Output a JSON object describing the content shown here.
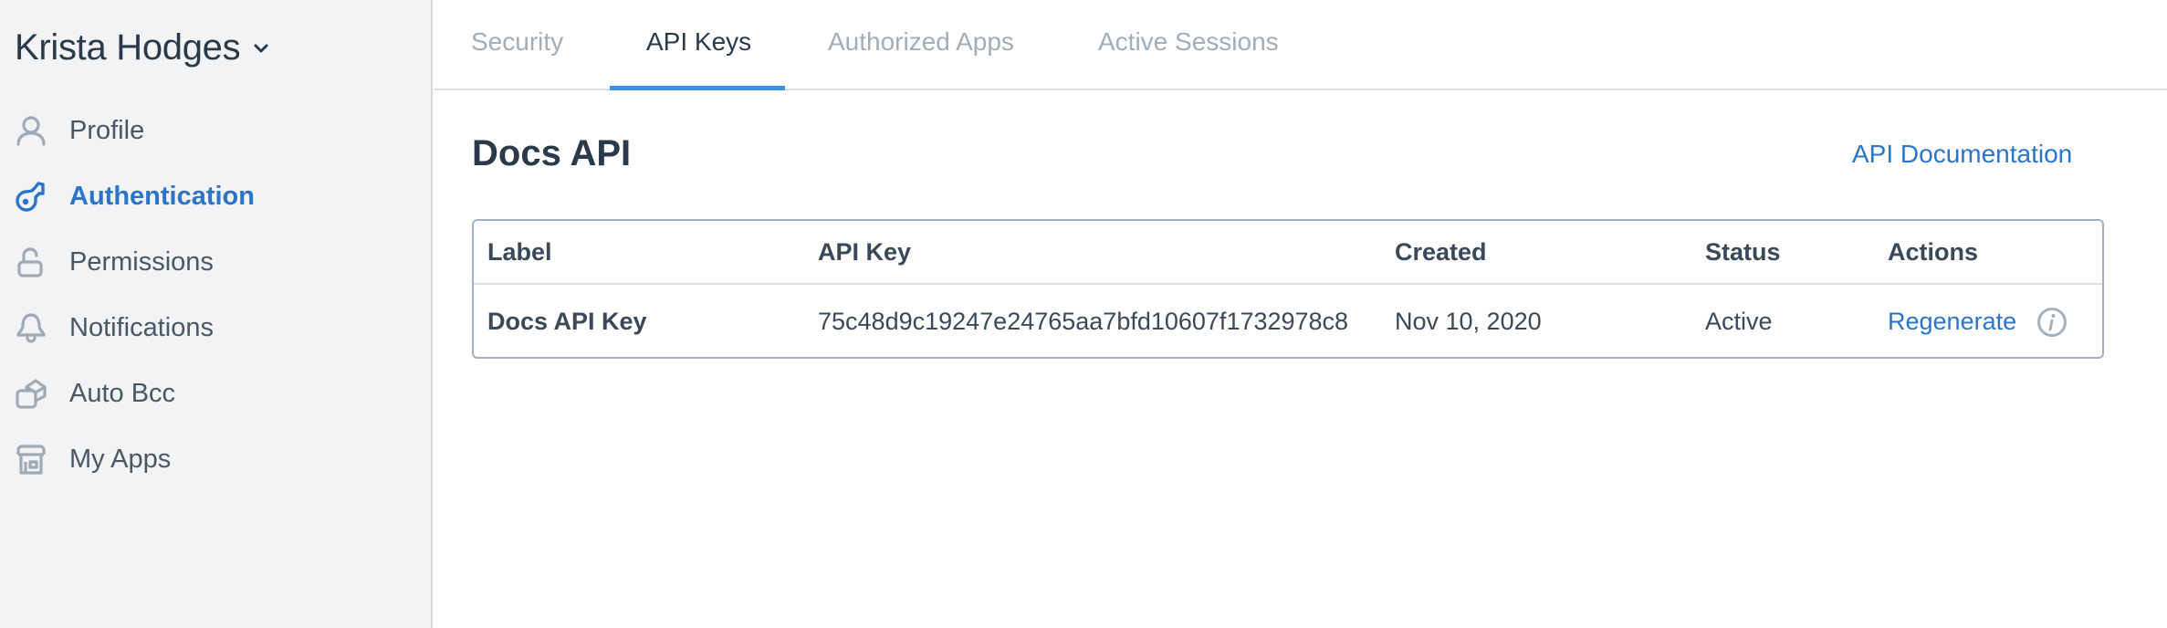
{
  "account": {
    "name": "Krista Hodges",
    "chevron_icon": "chevron-down-icon"
  },
  "sidebar": {
    "items": [
      {
        "label": "Profile",
        "icon": "user-icon",
        "active": false
      },
      {
        "label": "Authentication",
        "icon": "key-icon",
        "active": true
      },
      {
        "label": "Permissions",
        "icon": "unlock-icon",
        "active": false
      },
      {
        "label": "Notifications",
        "icon": "bell-icon",
        "active": false
      },
      {
        "label": "Auto Bcc",
        "icon": "envelope-stack-icon",
        "active": false
      },
      {
        "label": "My Apps",
        "icon": "storefront-icon",
        "active": false
      }
    ]
  },
  "tabs": [
    {
      "label": "Security",
      "active": false
    },
    {
      "label": "API Keys",
      "active": true
    },
    {
      "label": "Authorized Apps",
      "active": false
    },
    {
      "label": "Active Sessions",
      "active": false
    }
  ],
  "section": {
    "title": "Docs API",
    "doc_link": "API Documentation"
  },
  "table": {
    "columns": [
      "Label",
      "API Key",
      "Created",
      "Status",
      "Actions"
    ],
    "rows": [
      {
        "label": "Docs API Key",
        "api_key": "75c48d9c19247e24765aa7bfd10607f1732978c8",
        "created": "Nov 10, 2020",
        "status": "Active",
        "action": "Regenerate",
        "info_icon": "info-icon"
      }
    ]
  },
  "colors": {
    "accent": "#2c74c8",
    "tab_indicator": "#3d8fe4",
    "sidebar_bg": "#f1f3f5",
    "icon_grey": "#a0aab4",
    "text_dark": "#2b3a4a"
  }
}
